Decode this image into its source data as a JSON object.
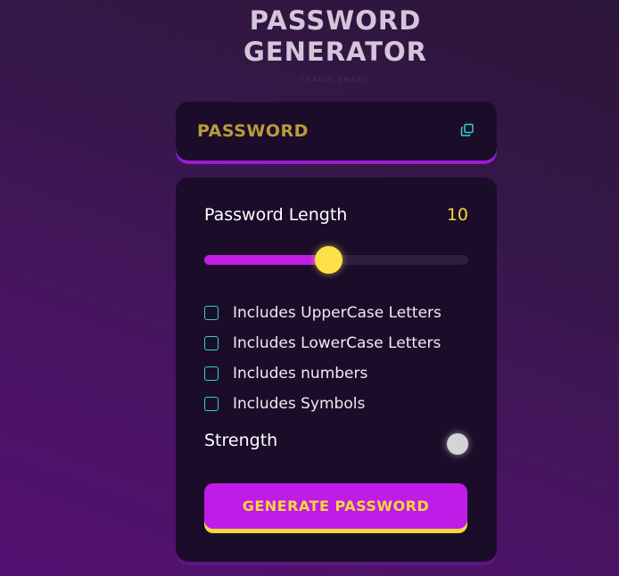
{
  "header": {
    "title_line1": "PASSWORD",
    "title_line2": "GENERATOR",
    "subtitle": "[HARIS SHAFI]"
  },
  "display": {
    "text": "PASSWORD",
    "copy_icon": "copy-icon"
  },
  "length": {
    "label": "Password Length",
    "value": "10",
    "slider_fraction": 0.47
  },
  "options": [
    {
      "label": "Includes UpperCase Letters",
      "checked": false
    },
    {
      "label": "Includes LowerCase Letters",
      "checked": false
    },
    {
      "label": "Includes numbers",
      "checked": false
    },
    {
      "label": "Includes Symbols",
      "checked": false
    }
  ],
  "strength": {
    "label": "Strength",
    "indicator_color": "#d4d4d4"
  },
  "generate_button": {
    "label": "GENERATE PASSWORD"
  },
  "colors": {
    "accent_yellow": "#f4d93a",
    "accent_purple": "#c11be8",
    "checkbox_border": "#2fd3d3",
    "panel_bg": "#1b0d29"
  }
}
